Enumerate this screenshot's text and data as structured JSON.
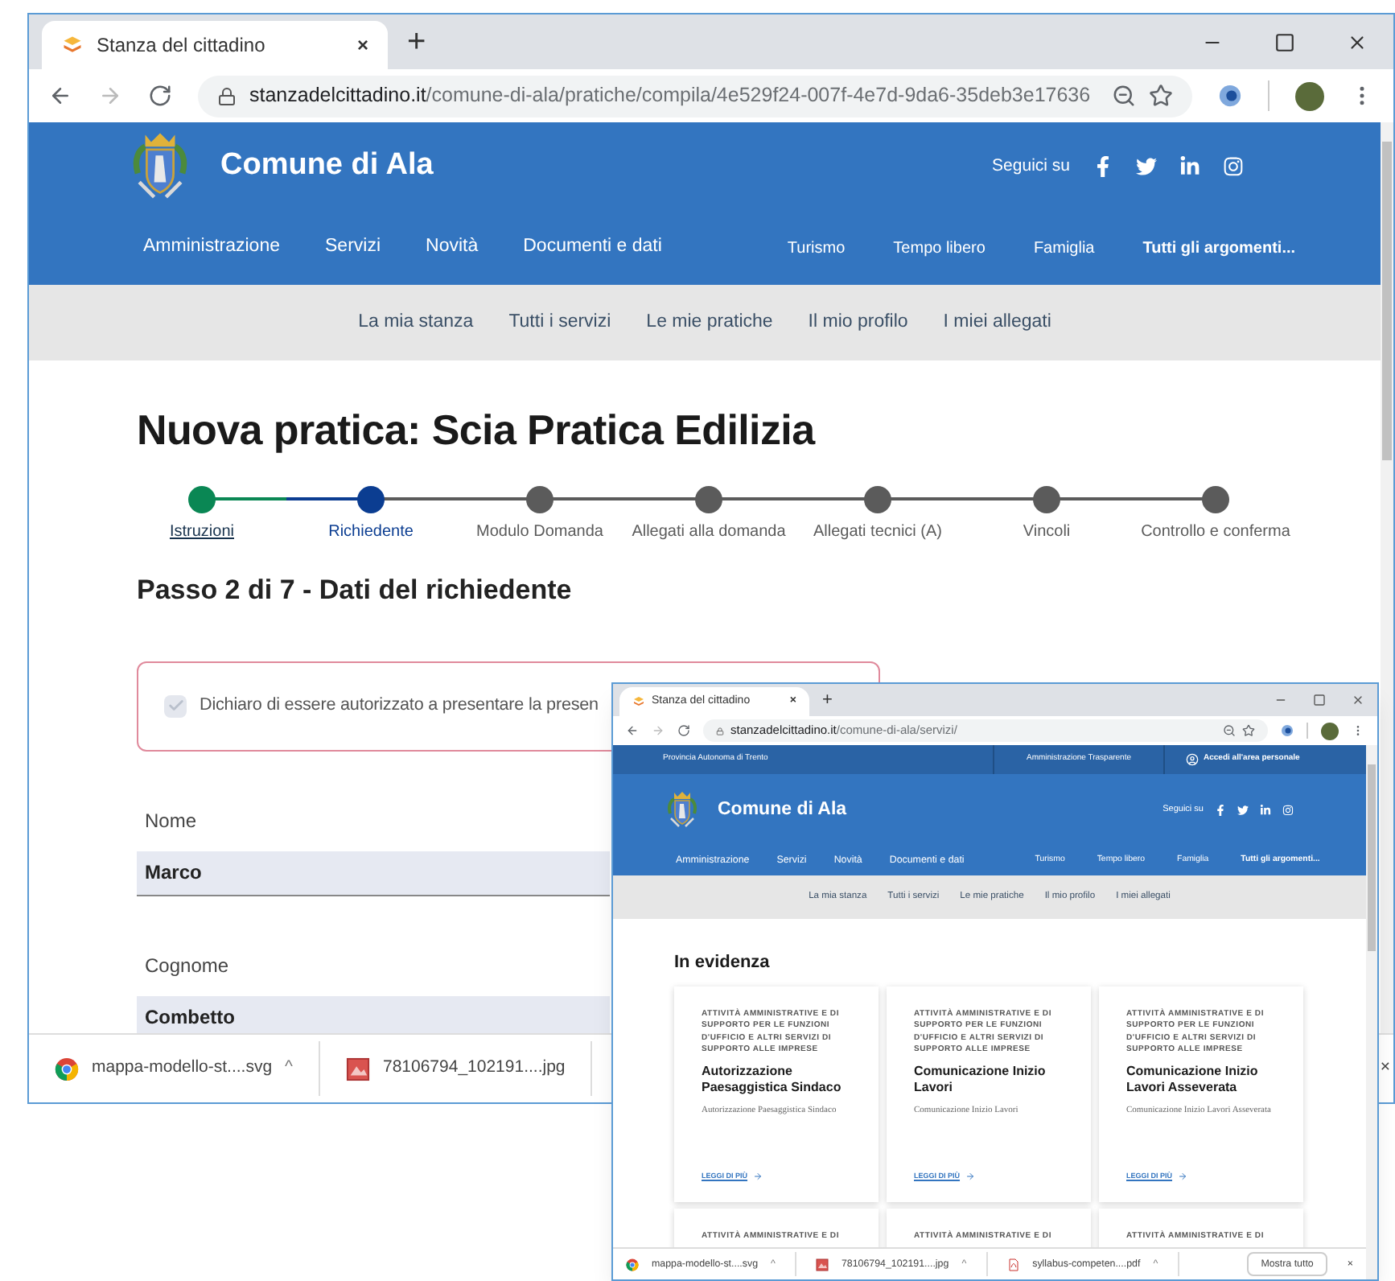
{
  "back_window": {
    "tab": {
      "title": "Stanza del cittadino",
      "close": "×"
    },
    "new_tab": "+",
    "address": {
      "domain": "stanzadelcittadino.it",
      "path": "/comune-di-ala/pratiche/compila/4e529f24-007f-4e7d-9da6-35deb3e17636"
    },
    "header": {
      "site_name": "Comune di Ala",
      "follow_label": "Seguici su"
    },
    "main_nav": [
      "Amministrazione",
      "Servizi",
      "Novità",
      "Documenti e dati"
    ],
    "topic_nav": [
      {
        "label": "Turismo",
        "emphasized": false
      },
      {
        "label": "Tempo libero",
        "emphasized": false
      },
      {
        "label": "Famiglia",
        "emphasized": false
      },
      {
        "label": "Tutti gli argomenti...",
        "emphasized": true
      }
    ],
    "sub_nav": [
      "La mia stanza",
      "Tutti i servizi",
      "Le mie pratiche",
      "Il mio profilo",
      "I miei allegati"
    ],
    "page_title": "Nuova pratica: Scia Pratica Edilizia",
    "steps": [
      {
        "label": "Istruzioni",
        "completed": true,
        "selected": false
      },
      {
        "label": "Richiedente",
        "completed": false,
        "selected": true
      },
      {
        "label": "Modulo Domanda",
        "completed": false,
        "selected": false
      },
      {
        "label": "Allegati alla domanda",
        "completed": false,
        "selected": false
      },
      {
        "label": "Allegati tecnici (A)",
        "completed": false,
        "selected": false
      },
      {
        "label": "Vincoli",
        "completed": false,
        "selected": false
      },
      {
        "label": "Controllo e conferma",
        "completed": false,
        "selected": false
      }
    ],
    "step_heading": "Passo 2 di 7 - Dati del richiedente",
    "declaration": {
      "label": "Dichiaro di essere autorizzato a presentare la presen",
      "checked": true
    },
    "fields": [
      {
        "label": "Nome",
        "value": "Marco"
      },
      {
        "label": "Cognome",
        "value": "Combetto"
      }
    ],
    "downloads": [
      {
        "name": "mappa-modello-st....svg",
        "kind": "chrome",
        "caret": "^"
      },
      {
        "name": "78106794_102191....jpg",
        "kind": "image"
      }
    ],
    "downloads_close": "×"
  },
  "front_window": {
    "tab": {
      "title": "Stanza del cittadino",
      "close": "×"
    },
    "new_tab": "+",
    "address": {
      "domain": "stanzadelcittadino.it",
      "path": "/comune-di-ala/servizi/"
    },
    "utility_bar": {
      "region": "Provincia Autonoma di Trento",
      "transparency": "Amministrazione Trasparente",
      "login": "Accedi all'area personale"
    },
    "header": {
      "site_name": "Comune di Ala",
      "follow_label": "Seguici su"
    },
    "main_nav": [
      "Amministrazione",
      "Servizi",
      "Novità",
      "Documenti e dati"
    ],
    "topic_nav": [
      {
        "label": "Turismo",
        "emphasized": false
      },
      {
        "label": "Tempo libero",
        "emphasized": false
      },
      {
        "label": "Famiglia",
        "emphasized": false
      },
      {
        "label": "Tutti gli argomenti...",
        "emphasized": true
      }
    ],
    "sub_nav": [
      "La mia stanza",
      "Tutti i servizi",
      "Le mie pratiche",
      "Il mio profilo",
      "I miei allegati"
    ],
    "section_title": "In evidenza",
    "cards": [
      {
        "category": "ATTIVITÀ AMMINISTRATIVE E DI SUPPORTO PER LE FUNZIONI D'UFFICIO E ALTRI SERVIZI DI SUPPORTO ALLE IMPRESE",
        "title": "Autorizzazione Paesaggistica Sindaco",
        "description": "Autorizzazione Paesaggistica Sindaco",
        "link": "LEGGI DI PIÙ"
      },
      {
        "category": "ATTIVITÀ AMMINISTRATIVE E DI SUPPORTO PER LE FUNZIONI D'UFFICIO E ALTRI SERVIZI DI SUPPORTO ALLE IMPRESE",
        "title": "Comunicazione Inizio Lavori",
        "description": "Comunicazione Inizio Lavori",
        "link": "LEGGI DI PIÙ"
      },
      {
        "category": "ATTIVITÀ AMMINISTRATIVE E DI SUPPORTO PER LE FUNZIONI D'UFFICIO E ALTRI SERVIZI DI SUPPORTO ALLE IMPRESE",
        "title": "Comunicazione Inizio Lavori Asseverata",
        "description": "Comunicazione Inizio Lavori Asseverata",
        "link": "LEGGI DI PIÙ"
      },
      {
        "category": "ATTIVITÀ AMMINISTRATIVE E DI"
      },
      {
        "category": "ATTIVITÀ AMMINISTRATIVE E DI"
      },
      {
        "category": "ATTIVITÀ AMMINISTRATIVE E DI"
      }
    ],
    "downloads": [
      {
        "name": "mappa-modello-st....svg",
        "kind": "chrome",
        "caret": "^"
      },
      {
        "name": "78106794_102191....jpg",
        "kind": "image",
        "caret": "^"
      },
      {
        "name": "syllabus-competen....pdf",
        "kind": "pdf",
        "caret": "^"
      }
    ],
    "show_all": "Mostra tutto",
    "downloads_close": "×"
  }
}
